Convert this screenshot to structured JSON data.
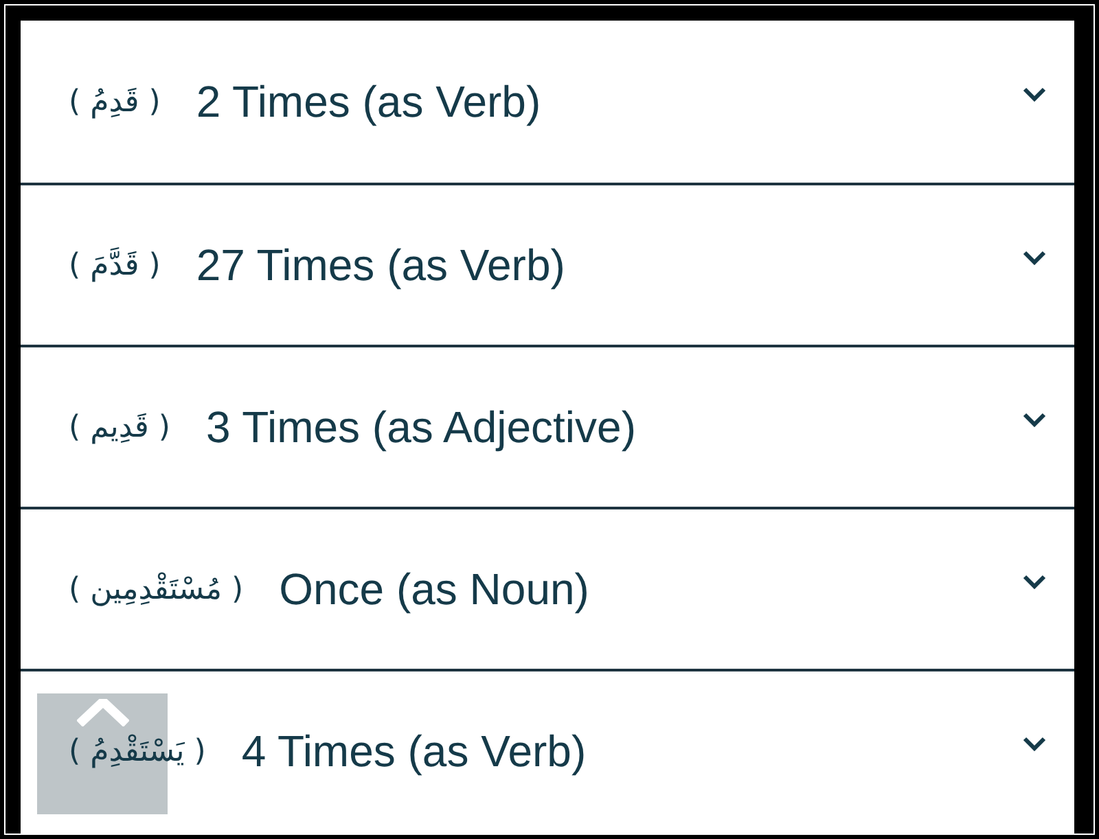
{
  "rows": [
    {
      "word": "( قَدِمُ )",
      "label": "2 Times (as Verb)",
      "expanded": false
    },
    {
      "word": "( قَدَّمَ )",
      "label": "27 Times (as Verb)",
      "expanded": false
    },
    {
      "word": "( قَدِيم )",
      "label": "3 Times (as Adjective)",
      "expanded": false
    },
    {
      "word": "( مُسْتَقْدِمِين )",
      "label": "Once (as Noun)",
      "expanded": false
    },
    {
      "word": "( يَسْتَقْدِمُ )",
      "label": "4 Times (as Verb)",
      "expanded": false
    }
  ]
}
